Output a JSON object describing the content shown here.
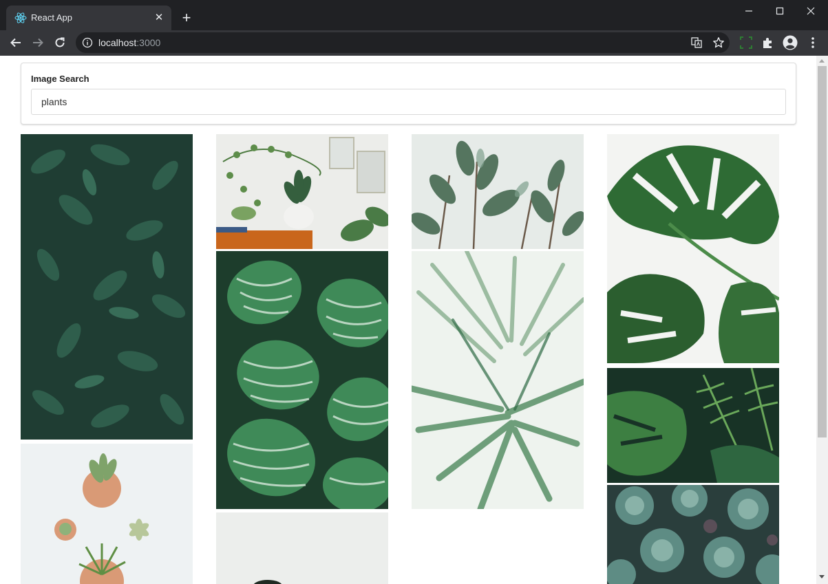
{
  "browser": {
    "tab_title": "React App",
    "url_host": "localhost",
    "url_port": ":3000"
  },
  "search": {
    "label": "Image Search",
    "value": "plants"
  },
  "results": [
    {
      "subject": "dense dark green leaves"
    },
    {
      "subject": "potted plants on shelf"
    },
    {
      "subject": "rubber plant leaves"
    },
    {
      "subject": "monstera leaves"
    },
    {
      "subject": "calathea striped leaves"
    },
    {
      "subject": "palm fronds"
    },
    {
      "subject": "potted succulents"
    },
    {
      "subject": "monstera and fern"
    },
    {
      "subject": "echeveria succulents"
    },
    {
      "subject": "plant silhouette"
    }
  ]
}
